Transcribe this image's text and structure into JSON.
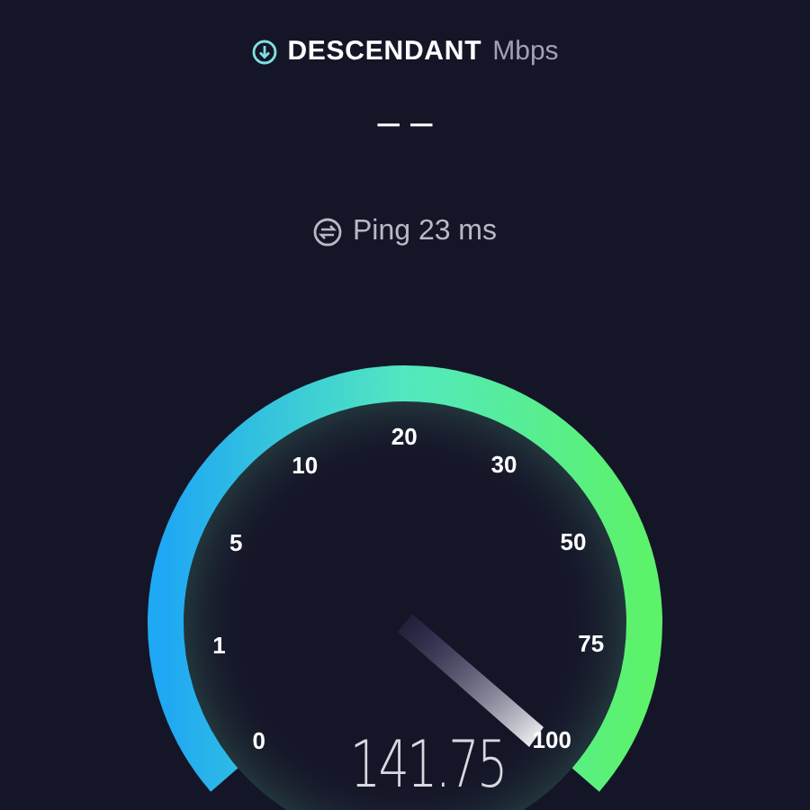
{
  "header": {
    "title": "DESCENDANT",
    "unit": "Mbps"
  },
  "result": "– –",
  "ping": {
    "label": "Ping 23 ms"
  },
  "gauge": {
    "ticks": [
      "0",
      "1",
      "5",
      "10",
      "20",
      "30",
      "50",
      "75",
      "100"
    ],
    "reading": "141.75"
  }
}
